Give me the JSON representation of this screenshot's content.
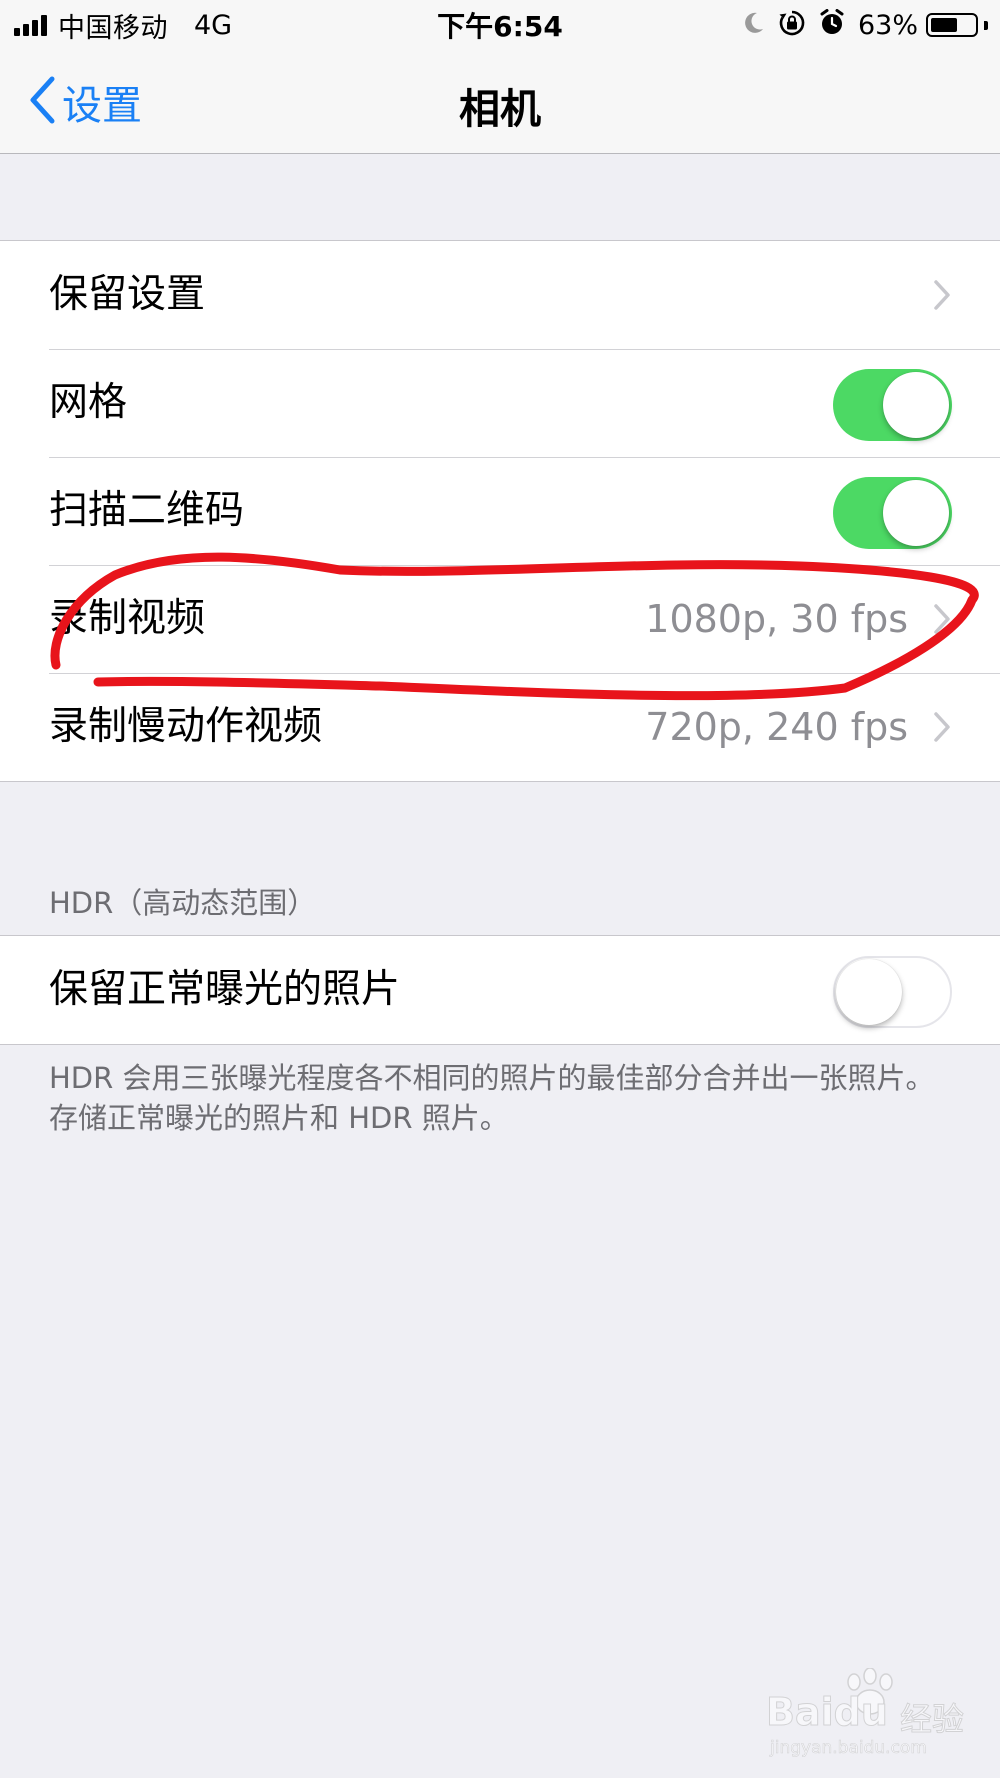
{
  "status_bar": {
    "carrier": "中国移动",
    "network": "4G",
    "time": "下午6:54",
    "battery_percent": "63%",
    "battery_level": 0.63,
    "icons": [
      "moon-icon",
      "rotation-lock-icon",
      "alarm-icon"
    ]
  },
  "nav": {
    "back_label": "设置",
    "title": "相机"
  },
  "group1": {
    "rows": [
      {
        "label": "保留设置",
        "value": "",
        "accessory": "chevron"
      },
      {
        "label": "网格",
        "accessory": "switch",
        "on": true
      },
      {
        "label": "扫描二维码",
        "accessory": "switch",
        "on": true
      },
      {
        "label": "录制视频",
        "value": "1080p, 30 fps",
        "accessory": "chevron"
      },
      {
        "label": "录制慢动作视频",
        "value": "720p, 240 fps",
        "accessory": "chevron"
      }
    ]
  },
  "hdr": {
    "header": "HDR（高动态范围）",
    "row_label": "保留正常曝光的照片",
    "row_on": false,
    "footer": "HDR 会用三张曝光程度各不相同的照片的最佳部分合并出一张照片。存储正常曝光的照片和 HDR 照片。"
  },
  "watermark": {
    "brand": "Baidu",
    "brand_cn": "经验",
    "url": "jingyan.baidu.com"
  },
  "colors": {
    "accent": "#1a80f5",
    "switch_on": "#4cd964",
    "annotation": "#e8141b",
    "background": "#efeff4"
  }
}
